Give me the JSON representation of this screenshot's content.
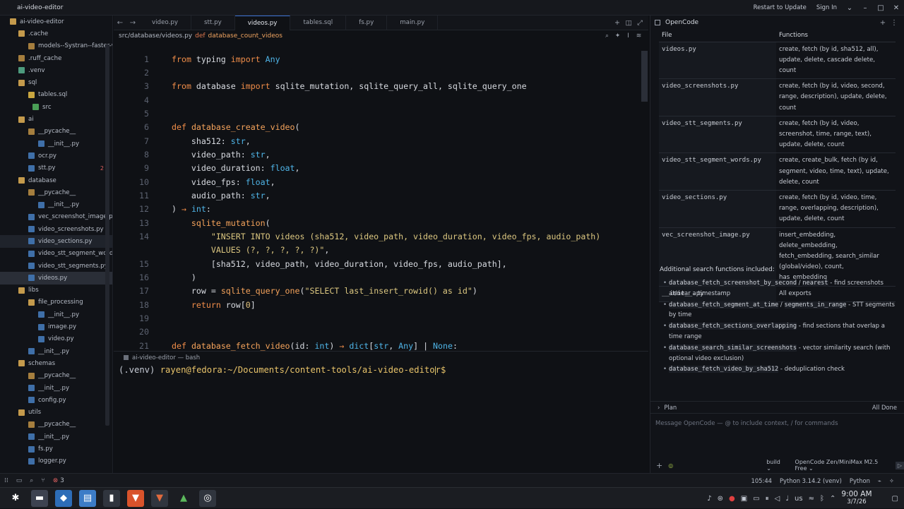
{
  "window": {
    "title": "ai-video-editor",
    "restart_label": "Restart to Update",
    "signin_label": "Sign In"
  },
  "sidebar": {
    "items": [
      {
        "label": "ai-video-editor",
        "icon": "folder-open-icon"
      },
      {
        "label": ".cache",
        "icon": "folder-open-icon"
      },
      {
        "label": "models--Systran--faster-wh",
        "icon": "folder-icon"
      },
      {
        "label": ".ruff_cache",
        "icon": "folder-icon"
      },
      {
        "label": ".venv",
        "icon": "venv-folder-icon"
      },
      {
        "label": "sql",
        "icon": "folder-open-icon"
      },
      {
        "label": "tables.sql",
        "icon": "sql-file-icon"
      },
      {
        "label": "src",
        "icon": "src-folder-icon"
      },
      {
        "label": "ai",
        "icon": "folder-open-icon"
      },
      {
        "label": "__pycache__",
        "icon": "folder-icon"
      },
      {
        "label": "__init__.py",
        "icon": "python-file-icon"
      },
      {
        "label": "ocr.py",
        "icon": "python-file-icon"
      },
      {
        "label": "stt.py",
        "icon": "python-file-icon",
        "badge": "2"
      },
      {
        "label": "database",
        "icon": "folder-open-icon"
      },
      {
        "label": "__pycache__",
        "icon": "folder-icon"
      },
      {
        "label": "__init__.py",
        "icon": "python-file-icon"
      },
      {
        "label": "vec_screenshot_image.py",
        "icon": "python-file-icon"
      },
      {
        "label": "video_screenshots.py",
        "icon": "python-file-icon"
      },
      {
        "label": "video_sections.py",
        "icon": "python-file-icon"
      },
      {
        "label": "video_stt_segment_words.py",
        "icon": "python-file-icon"
      },
      {
        "label": "video_stt_segments.py",
        "icon": "python-file-icon"
      },
      {
        "label": "videos.py",
        "icon": "python-file-icon"
      },
      {
        "label": "libs",
        "icon": "folder-open-icon"
      },
      {
        "label": "file_processing",
        "icon": "folder-open-icon"
      },
      {
        "label": "__init__.py",
        "icon": "python-file-icon"
      },
      {
        "label": "image.py",
        "icon": "python-file-icon"
      },
      {
        "label": "video.py",
        "icon": "python-file-icon"
      },
      {
        "label": "__init__.py",
        "icon": "python-file-icon"
      },
      {
        "label": "schemas",
        "icon": "folder-open-icon"
      },
      {
        "label": "__pycache__",
        "icon": "folder-icon"
      },
      {
        "label": "__init__.py",
        "icon": "python-file-icon"
      },
      {
        "label": "config.py",
        "icon": "python-file-icon"
      },
      {
        "label": "utils",
        "icon": "folder-open-icon"
      },
      {
        "label": "__pycache__",
        "icon": "folder-icon"
      },
      {
        "label": "__init__.py",
        "icon": "python-file-icon"
      },
      {
        "label": "fs.py",
        "icon": "python-file-icon"
      },
      {
        "label": "logger.py",
        "icon": "python-file-icon"
      }
    ]
  },
  "editor": {
    "tabs": [
      "video.py",
      "stt.py",
      "videos.py",
      "tables.sql",
      "fs.py",
      "main.py"
    ],
    "active_tab": "videos.py",
    "breadcrumb": {
      "path": "src/database/videos.py",
      "kw": "def",
      "fn": "database_count_videos"
    },
    "lines": [
      "1",
      "2",
      "3",
      "4",
      "5",
      "6",
      "7",
      "8",
      "9",
      "10",
      "11",
      "12",
      "13",
      "14",
      "",
      "15",
      "16",
      "17",
      "18",
      "19",
      "20",
      "21"
    ]
  },
  "terminal": {
    "tab_label": "ai-video-editor — bash",
    "venv": "(.venv)",
    "prompt": "rayen@fedora:~/Documents/content-tools/ai-video-edito",
    "prompt_end": "r$"
  },
  "opencode": {
    "title": "OpenCode",
    "table_headers": [
      "File",
      "Functions"
    ],
    "rows": [
      {
        "file": "videos.py",
        "funcs": "create, fetch (by id, sha512, all), update, delete, cascade delete, count"
      },
      {
        "file": "video_screenshots.py",
        "funcs": "create, fetch (by id, video, second, range, description), update, delete, count"
      },
      {
        "file": "video_stt_segments.py",
        "funcs": "create, fetch (by id, video, screenshot, time, range, text), update, delete, count"
      },
      {
        "file": "video_stt_segment_words.py",
        "funcs": "create, create_bulk, fetch (by id, segment, video, time, text), update, delete, count"
      },
      {
        "file": "video_sections.py",
        "funcs": "create, fetch (by id, video, time, range, overlapping, description), update, delete, count"
      },
      {
        "file": "vec_screenshot_image.py",
        "funcs": "insert_embedding, delete_embedding, fetch_embedding, search_similar (global/video), count, has_embedding"
      },
      {
        "file": "__init__.py",
        "funcs": "All exports"
      }
    ],
    "additional_heading": "Additional search functions included:",
    "additional": [
      {
        "code": "database_fetch_screenshot_by_second",
        "mid": " / ",
        "code2": "nearest",
        "text": " - find screenshots at/near a timestamp"
      },
      {
        "code": "database_fetch_segment_at_time",
        "mid": " / ",
        "code2": "segments_in_range",
        "text": " - STT segments by time"
      },
      {
        "code": "database_fetch_sections_overlapping",
        "mid": "",
        "code2": "",
        "text": " - find sections that overlap a time range"
      },
      {
        "code": "database_search_similar_screenshots",
        "mid": "",
        "code2": "",
        "text": " - vector similarity search (with optional video exclusion)"
      },
      {
        "code": "database_fetch_video_by_sha512",
        "mid": "",
        "code2": "",
        "text": " - deduplication check"
      }
    ],
    "plan_label": "Plan",
    "plan_status": "All Done",
    "input_placeholder": "Message OpenCode — @ to include context, / for commands",
    "build_label": "build",
    "model_label": "OpenCode Zen/MiniMax M2.5 Free"
  },
  "statusbar": {
    "errors": "3",
    "position": "105:44",
    "python_env": "Python 3.14.2 (venv)",
    "language": "Python"
  },
  "taskbar": {
    "keyboard": "us",
    "time": "9:00 AM",
    "date": "3/7/26"
  }
}
